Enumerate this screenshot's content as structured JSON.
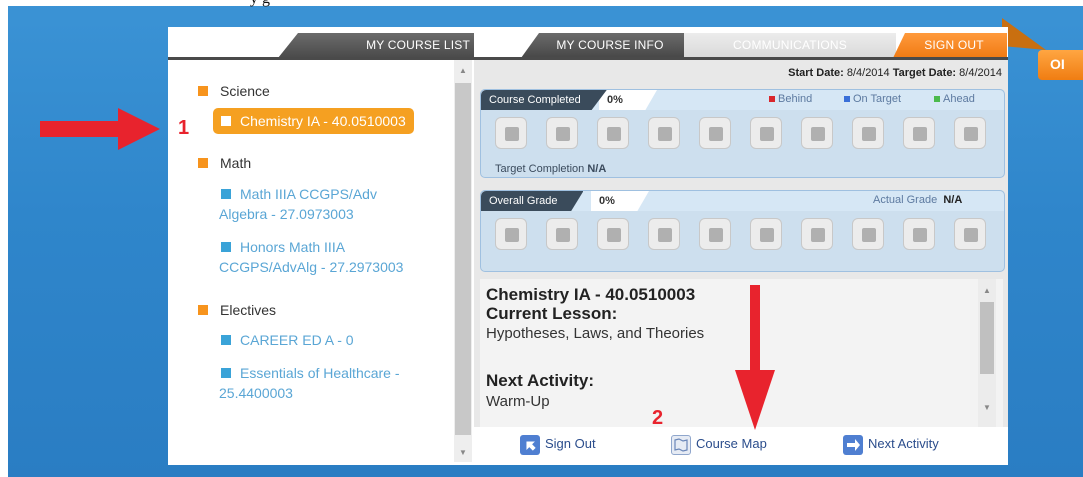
{
  "page": {
    "top_text_fragment": "y                                        g"
  },
  "side_button": {
    "label": "OI"
  },
  "tabs": {
    "course_list": "MY COURSE LIST",
    "course_info": "MY COURSE INFO",
    "communications": "COMMUNICATIONS",
    "sign_out": "SIGN OUT"
  },
  "sidebar": {
    "categories": [
      {
        "name": "Science",
        "courses": [
          "Chemistry IA - 40.0510003"
        ]
      },
      {
        "name": "Math",
        "courses": [
          "Math IIIA CCGPS/Adv Algebra - 27.0973003",
          "Honors Math IIIA CCGPS/AdvAlg - 27.2973003"
        ]
      },
      {
        "name": "Electives",
        "courses": [
          "CAREER ED A - 0",
          "Essentials of Healthcare - 25.4400003"
        ]
      }
    ],
    "course_lines": {
      "chem": "Chemistry IA - 40.0510003",
      "math1a": "Math IIIA CCGPS/Adv",
      "math1b": "Algebra - 27.0973003",
      "math2a": "Honors Math IIIA",
      "math2b": "CCGPS/AdvAlg - 27.2973003",
      "career": "CAREER ED A - 0",
      "health_a": "Essentials of Healthcare -",
      "health_b": "25.4400003"
    },
    "selected_course": "Chemistry IA - 40.0510003"
  },
  "dates": {
    "start_label": "Start Date:",
    "start_value": "8/4/2014",
    "target_label": "Target Date:",
    "target_value": "8/4/2014"
  },
  "course_completed": {
    "label": "Course Completed",
    "percent": "0%",
    "progress_fraction": 0,
    "legend": [
      {
        "label": "Behind",
        "color": "#d9262c"
      },
      {
        "label": "On Target",
        "color": "#3a6fd8"
      },
      {
        "label": "Ahead",
        "color": "#4cba4c"
      }
    ],
    "target_completion_label": "Target Completion",
    "target_completion_value": "N/A"
  },
  "overall_grade": {
    "label": "Overall Grade",
    "percent": "0%",
    "actual_grade_label": "Actual Grade",
    "actual_grade_value": "N/A"
  },
  "lesson_info": {
    "course_title": "Chemistry IA - 40.0510003",
    "current_lesson_label": "Current Lesson:",
    "current_lesson": "Hypotheses, Laws, and Theories",
    "next_activity_label": "Next Activity:",
    "next_activity": "Warm-Up"
  },
  "bottom_actions": {
    "sign_out": "Sign Out",
    "course_map": "Course Map",
    "next_activity": "Next Activity"
  },
  "annotations": {
    "marker_1": "1",
    "marker_2": "2",
    "arrow_color": "#e8232d"
  },
  "colors": {
    "accent_orange": "#f5a021",
    "dark_tab": "#4a4a4a",
    "link_blue": "#5aa6d5"
  }
}
